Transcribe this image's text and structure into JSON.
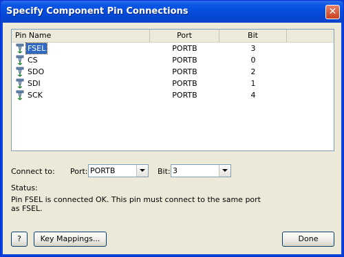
{
  "window": {
    "title": "Specify Component Pin Connections"
  },
  "list": {
    "columns": [
      "Pin Name",
      "Port",
      "Bit",
      ""
    ],
    "rows": [
      {
        "name": "FSEL",
        "port": "PORTB",
        "bit": "3",
        "selected": true
      },
      {
        "name": "CS",
        "port": "PORTB",
        "bit": "0",
        "selected": false
      },
      {
        "name": "SDO",
        "port": "PORTB",
        "bit": "2",
        "selected": false
      },
      {
        "name": "SDI",
        "port": "PORTB",
        "bit": "1",
        "selected": false
      },
      {
        "name": "SCK",
        "port": "PORTB",
        "bit": "4",
        "selected": false
      }
    ]
  },
  "connect": {
    "label": "Connect to:",
    "port_label": "Port:",
    "port_value": "PORTB",
    "bit_label": "Bit:",
    "bit_value": "3"
  },
  "status": {
    "label": "Status:",
    "line1": "Pin FSEL is connected OK. This pin must connect to the same port",
    "line2": "as FSEL."
  },
  "buttons": {
    "help": "?",
    "key_mappings": "Key Mappings...",
    "done": "Done"
  },
  "icons": {
    "pin": "pin-icon",
    "close": "close-icon",
    "dropdown": "chevron-down-icon"
  }
}
